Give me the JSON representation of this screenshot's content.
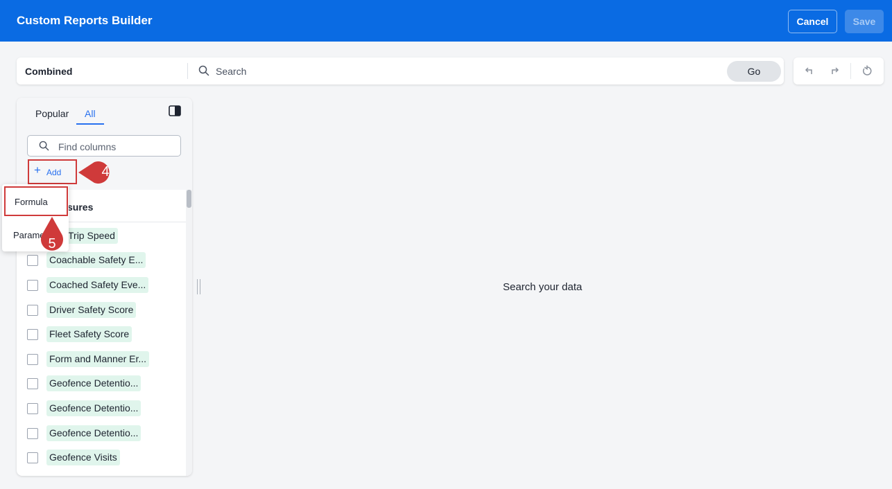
{
  "header": {
    "title": "Custom Reports Builder",
    "cancel_label": "Cancel",
    "save_label": "Save"
  },
  "searchbar": {
    "source": "Combined",
    "placeholder": "Search",
    "go_label": "Go"
  },
  "toolbar": {
    "icons": [
      "undo-icon",
      "redo-icon",
      "reset-icon"
    ]
  },
  "panel": {
    "tabs": [
      "Popular",
      "All"
    ],
    "active_tab": "All",
    "find_placeholder": "Find columns",
    "add_label": "Add",
    "section_title_visible": "sures",
    "columns": [
      "age Trip Speed",
      "Coachable Safety E...",
      "Coached Safety Eve...",
      "Driver Safety Score",
      "Fleet Safety Score",
      "Form and Manner Er...",
      "Geofence Detentio...",
      "Geofence Detentio...",
      "Geofence Detentio...",
      "Geofence Visits"
    ]
  },
  "dropdown": {
    "items": [
      "Formula",
      "Parameter"
    ]
  },
  "main": {
    "empty_message": "Search your data"
  },
  "callouts": {
    "step4": "4",
    "step5": "5"
  },
  "colors": {
    "brand": "#0a6be3",
    "accent": "#2770ef",
    "chip": "#e0f5ec",
    "callout": "#cf3a3a"
  }
}
